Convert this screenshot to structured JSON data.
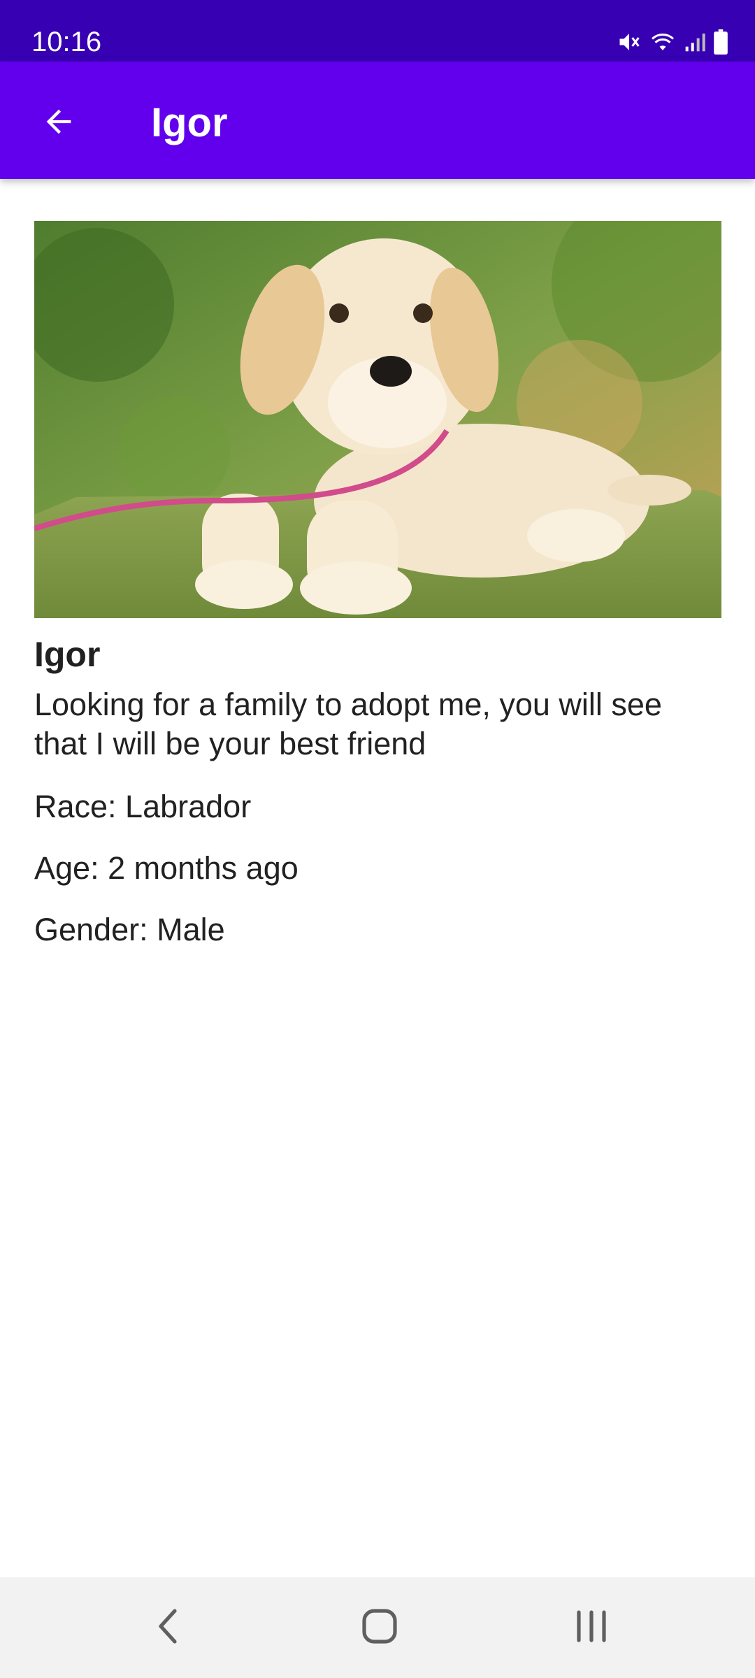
{
  "status_bar": {
    "time": "10:16",
    "icons": [
      "mute-icon",
      "wifi-icon",
      "signal-icon",
      "battery-icon"
    ]
  },
  "app_bar": {
    "title": "Igor",
    "back_icon": "arrow-back-icon"
  },
  "pet": {
    "image_subject": "labrador-puppy-photo",
    "name": "Igor",
    "description": "Looking for a family to adopt me, you will see that I will be your best friend",
    "race": "Race: Labrador",
    "age": "Age: 2 months ago",
    "gender": "Gender: Male"
  },
  "nav_bar": {
    "icons": [
      "nav-back-icon",
      "nav-home-icon",
      "nav-recents-icon"
    ]
  },
  "colors": {
    "status_bar": "#3700b3",
    "app_bar": "#6200ee",
    "text": "#212121",
    "nav_bar": "#f2f2f2"
  }
}
